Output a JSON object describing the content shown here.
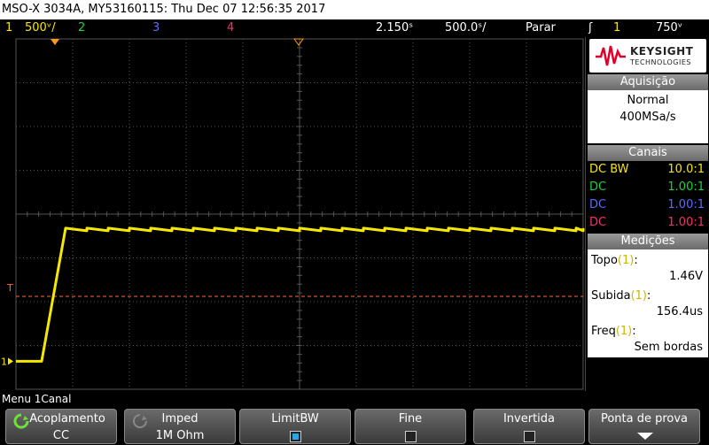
{
  "title": "MSO-X 3034A, MY53160115: Thu Dec 07 12:56:35 2017",
  "status": {
    "ch1_num": "1",
    "ch1_scale": "500ᵛ/",
    "ch2_num": "2",
    "ch3_num": "3",
    "ch4_num": "4",
    "time_delay": "2.150ˢ",
    "time_scale": "500.0ˢ/",
    "run_state": "Parar",
    "trigger_symbol": "ʃ",
    "trigger_ch": "1",
    "trigger_level": "750ᵛ"
  },
  "colors": {
    "ch1": "#f5e800",
    "ch2": "#19d43b",
    "ch3": "#5b6bff",
    "ch4": "#ff2d6b",
    "grid": "#555555",
    "trigger_line": "#ff6a3a",
    "marker": "#ff9a1a"
  },
  "screen": {
    "trigger_marker": "T",
    "ground_marker": "1",
    "trigger_level_fraction": 0.735,
    "ground_level_fraction": 0.92,
    "high_level_fraction": 0.54
  },
  "brand": {
    "name": "KEYSIGHT",
    "sub": "TECHNOLOGIES",
    "logo_icon": "keysight-wave-icon"
  },
  "acquisition": {
    "header": "Aquisição",
    "mode": "Normal",
    "rate": "400MSa/s"
  },
  "channels": {
    "header": "Canais",
    "rows": [
      {
        "coupling": "DC BW",
        "probe": "10.0:1"
      },
      {
        "coupling": "DC",
        "probe": "1.00:1"
      },
      {
        "coupling": "DC",
        "probe": "1.00:1"
      },
      {
        "coupling": "DC",
        "probe": "1.00:1"
      }
    ]
  },
  "measurements": {
    "header": "Medições",
    "items": [
      {
        "name": "Topo",
        "ch": "(1)",
        "suffix": ":",
        "value": "1.46V"
      },
      {
        "name": "Subida",
        "ch": "(1)",
        "suffix": ":",
        "value": "156.4us"
      },
      {
        "name": "Freq",
        "ch": "(1)",
        "suffix": ":",
        "value": "Sem bordas"
      }
    ]
  },
  "menu_label": "Menu 1Canal",
  "softkeys": {
    "coupling": {
      "title": "Acoplamento",
      "value": "CC"
    },
    "imped": {
      "title": "Imped",
      "value": "1M Ohm"
    },
    "limitbw": {
      "title": "LimitBW"
    },
    "fine": {
      "title": "Fine"
    },
    "invert": {
      "title": "Invertida"
    },
    "probe": {
      "title": "Ponta de prova"
    }
  }
}
